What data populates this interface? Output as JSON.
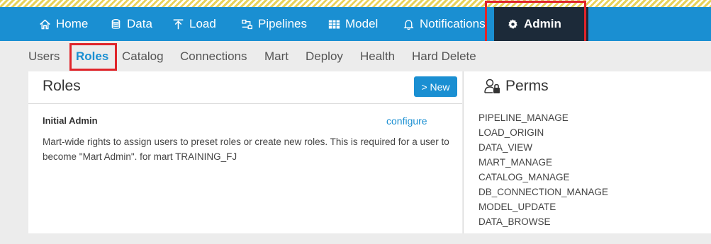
{
  "nav": {
    "home": "Home",
    "data": "Data",
    "load": "Load",
    "pipelines": "Pipelines",
    "model": "Model",
    "notifications": "Notifications",
    "admin": "Admin"
  },
  "subnav": [
    "Users",
    "Roles",
    "Catalog",
    "Connections",
    "Mart",
    "Deploy",
    "Health",
    "Hard Delete"
  ],
  "roles_panel": {
    "title": "Roles",
    "new_button": "> New",
    "role": {
      "name": "Initial Admin",
      "configure_link": "configure",
      "description": "Mart-wide rights to assign users to preset roles or create new roles. This is required for a user to become \"Mart Admin\". for mart TRAINING_FJ"
    }
  },
  "perms_panel": {
    "title": "Perms",
    "items": [
      "PIPELINE_MANAGE",
      "LOAD_ORIGIN",
      "DATA_VIEW",
      "MART_MANAGE",
      "CATALOG_MANAGE",
      "DB_CONNECTION_MANAGE",
      "MODEL_UPDATE",
      "DATA_BROWSE"
    ]
  },
  "colors": {
    "nav_bg": "#1a8fd2",
    "active_nav_bg": "#1c2a39",
    "highlight": "#e0242a",
    "accent": "#1a8fd2"
  },
  "icons": [
    "home-icon",
    "database-icon",
    "upload-icon",
    "pipelines-icon",
    "model-icon",
    "bell-icon",
    "gear-icon",
    "user-lock-icon"
  ]
}
